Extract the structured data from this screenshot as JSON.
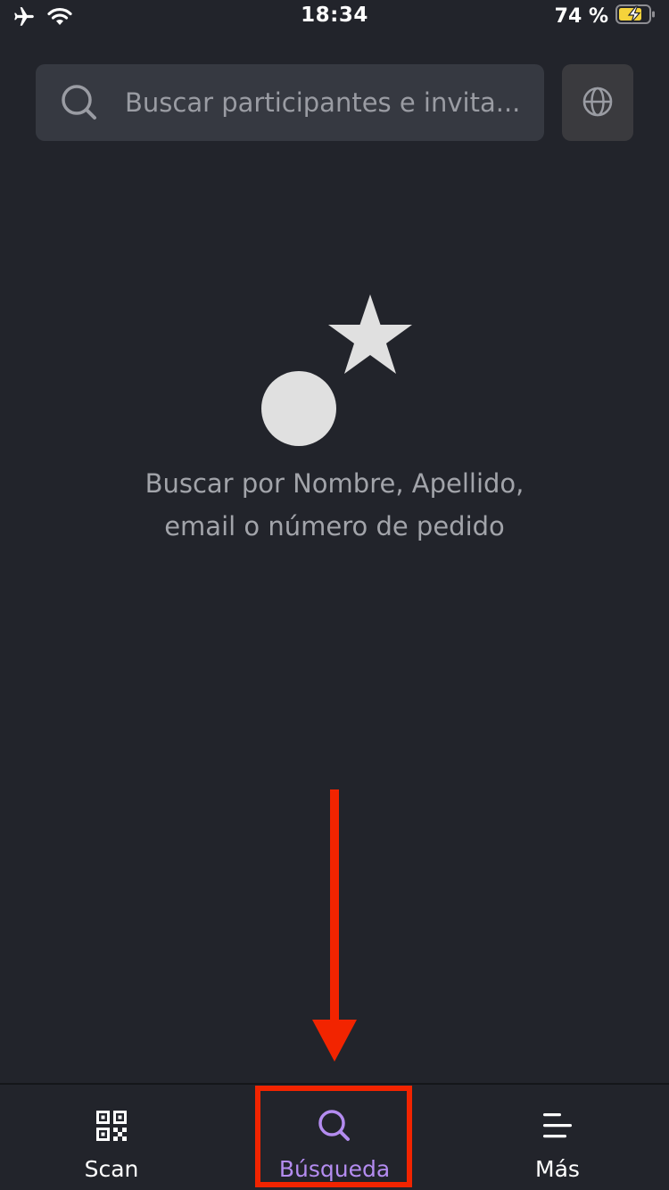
{
  "status_bar": {
    "time": "18:34",
    "battery_percent": "74 %",
    "icons": [
      "airplane-mode-icon",
      "wifi-icon",
      "battery-charging-icon"
    ]
  },
  "search": {
    "placeholder": "Buscar participantes e invita...",
    "value": "",
    "icon": "search-icon",
    "side_button_icon": "globe-icon"
  },
  "empty_state": {
    "icon": "shapes-illustration",
    "message_line1": "Buscar por Nombre, Apellido,",
    "message_line2": "email o número de pedido"
  },
  "tab_bar": {
    "items": [
      {
        "label": "Scan",
        "icon": "qr-code-icon",
        "active": false
      },
      {
        "label": "Búsqueda",
        "icon": "search-icon",
        "active": true
      },
      {
        "label": "Más",
        "icon": "menu-lines-icon",
        "active": false
      }
    ]
  },
  "colors": {
    "background": "#22242b",
    "search_field": "#363941",
    "active_tab": "#b48cf0",
    "annotation": "#f22400",
    "muted_text": "#a2a4aa"
  }
}
